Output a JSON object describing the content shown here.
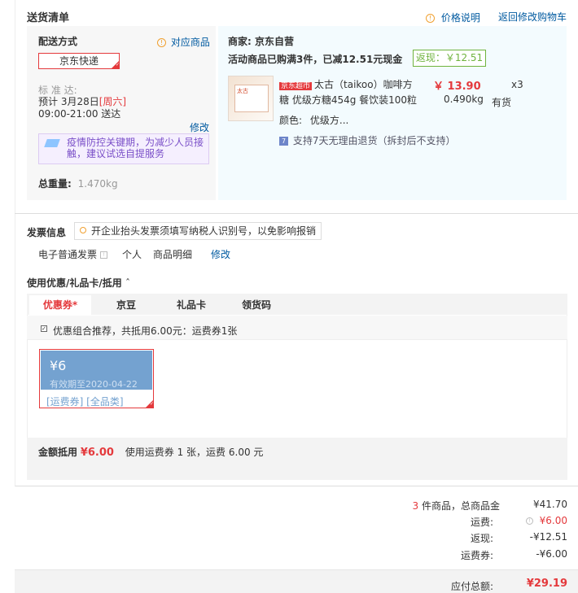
{
  "header": {
    "title": "送货清单",
    "price_note": "价格说明",
    "back_to_cart": "返回修改购物车"
  },
  "delivery": {
    "label": "配送方式",
    "match_goods": "对应商品",
    "method": "京东快递",
    "standard_label": "标 准 达:",
    "date_prefix": "预计 3月28日",
    "weekday": "[周六]",
    "time": "09:00-21:00 送达",
    "modify": "修改",
    "notice": "疫情防控关键期，为减少人员接触，建议试选自提服务",
    "weight_label": "总重量:",
    "weight": "1.470kg"
  },
  "merchant": {
    "label": "商家: 京东自营",
    "promo": "活动商品已购满3件，已减12.51元现金",
    "rebate": "返现：￥12.51",
    "product": {
      "tag": "京东超市",
      "title": "太古（taikoo）咖啡方糖 优级方糖454g 餐饮装100粒",
      "price": "￥ 13.90",
      "qty": "x3",
      "weight": "0.490kg",
      "stock": "有货",
      "color_label": "颜色:",
      "color": "优级方...",
      "img_text": "太古"
    },
    "return_policy": "支持7天无理由退货（拆封后不支持）"
  },
  "invoice": {
    "title": "发票信息",
    "tip": "开企业抬头发票须填写纳税人识别号，以免影响报销",
    "type": "电子普通发票",
    "person": "个人",
    "detail": "商品明细",
    "modify": "修改"
  },
  "coupon": {
    "section_title": "使用优惠/礼品卡/抵用",
    "tabs": [
      "优惠券*",
      "京豆",
      "礼品卡",
      "领货码"
    ],
    "combo": "优惠组合推荐，共抵用6.00元：运费券1张",
    "card": {
      "amount": "¥6",
      "expiry": "有效期至2020-04-22",
      "tags": "[运费券] [全品类]"
    },
    "summary_label": "金额抵用",
    "summary_amount": "¥6.00",
    "summary_detail": "使用运费券 1 张，运费 6.00 元"
  },
  "totals": {
    "count": "3",
    "count_suffix": " 件商品，总商品金",
    "goods_amount": "¥41.70",
    "shipping_label": "运费:",
    "shipping": "¥6.00",
    "rebate_label": "返现:",
    "rebate": "-¥12.51",
    "voucher_label": "运费券:",
    "voucher": "-¥6.00",
    "payable_label": "应付总额:",
    "payable": "¥29.19"
  },
  "colors": {
    "accent": "#e4393c",
    "link": "#005aa0",
    "panel_blue": "#f3fbfe",
    "panel_gray": "#f7f7f7",
    "coupon_blue": "#74a2d0"
  }
}
